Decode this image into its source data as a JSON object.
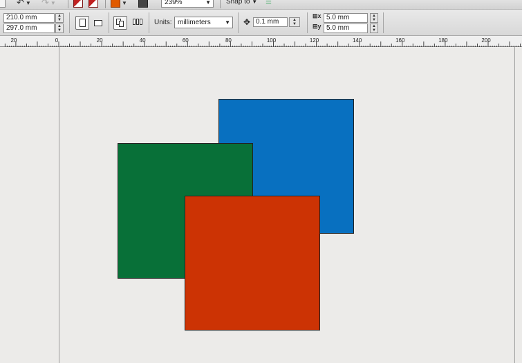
{
  "toolbar_top": {
    "zoom_value": "239%",
    "snap_label": "Snap to"
  },
  "property_bar": {
    "page_width": "210.0 mm",
    "page_height": "297.0 mm",
    "units_label": "Units:",
    "units_value": "millimeters",
    "nudge_value": "0.1 mm",
    "duplicate_x": "5.0 mm",
    "duplicate_y": "5.0 mm"
  },
  "ruler": {
    "unit": "millimeters",
    "labels": [
      "20",
      "0",
      "20",
      "40",
      "60",
      "80",
      "100",
      "120",
      "140",
      "160",
      "180",
      "200"
    ]
  },
  "canvas": {
    "shapes": [
      {
        "name": "blue-square",
        "fill": "#0870c0"
      },
      {
        "name": "green-square",
        "fill": "#087038"
      },
      {
        "name": "red-square",
        "fill": "#cc3304"
      }
    ]
  }
}
